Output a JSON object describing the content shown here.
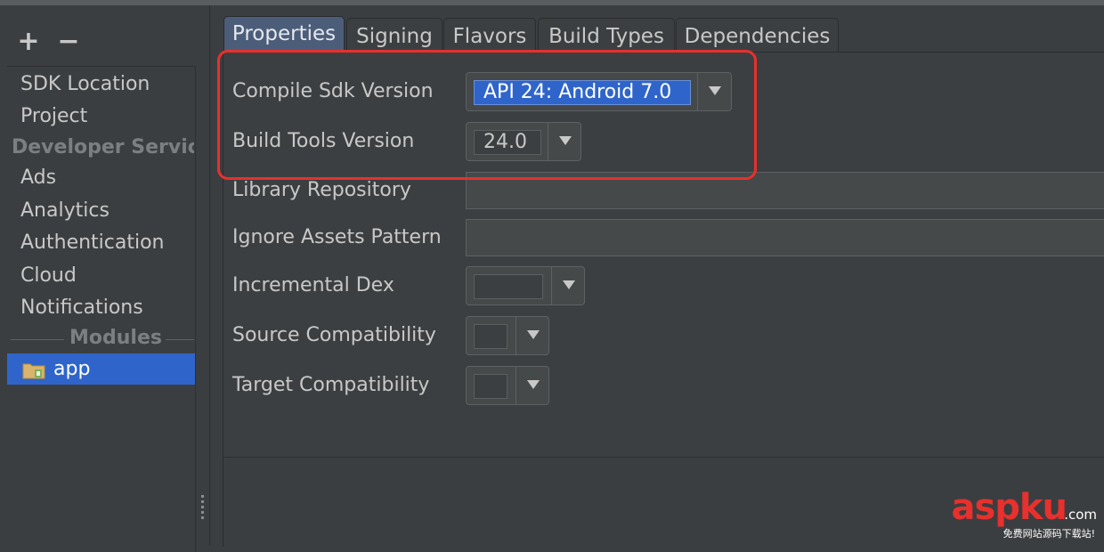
{
  "toolbar": {
    "add_label": "+",
    "remove_label": "−"
  },
  "sidebar": {
    "items": [
      {
        "label": "SDK Location"
      },
      {
        "label": "Project"
      }
    ],
    "group_developer": "Developer Servic",
    "dev_items": [
      {
        "label": "Ads"
      },
      {
        "label": "Analytics"
      },
      {
        "label": "Authentication"
      },
      {
        "label": "Cloud"
      },
      {
        "label": "Notifications"
      }
    ],
    "group_modules": "Modules",
    "selected_module": "app"
  },
  "tabs": [
    {
      "label": "Properties",
      "active": true
    },
    {
      "label": "Signing"
    },
    {
      "label": "Flavors"
    },
    {
      "label": "Build Types"
    },
    {
      "label": "Dependencies"
    }
  ],
  "properties": {
    "compile_sdk": {
      "label": "Compile Sdk Version",
      "value": "API 24: Android 7.0"
    },
    "build_tools": {
      "label": "Build Tools Version",
      "value": "24.0"
    },
    "library_repository": {
      "label": "Library Repository",
      "value": ""
    },
    "ignore_assets": {
      "label": "Ignore Assets Pattern",
      "value": ""
    },
    "incremental_dex": {
      "label": "Incremental Dex",
      "value": ""
    },
    "source_compat": {
      "label": "Source Compatibility",
      "value": ""
    },
    "target_compat": {
      "label": "Target Compatibility",
      "value": ""
    }
  },
  "watermark": {
    "brand": "aspku",
    "tld": ".com",
    "subtitle": "免费网站源码下载站!"
  },
  "colors": {
    "selection": "#2f65ca",
    "highlight": "#e8302d",
    "background": "#3c3f41"
  }
}
